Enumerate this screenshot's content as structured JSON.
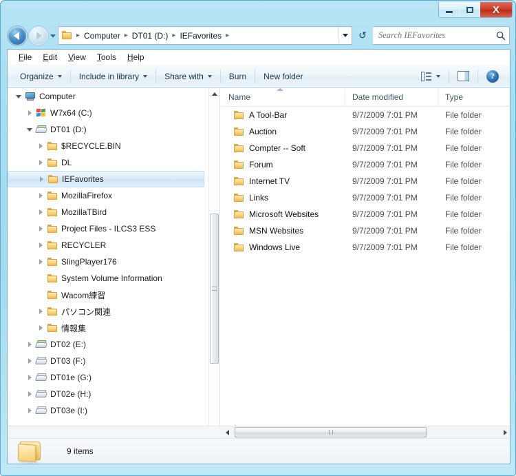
{
  "window": {
    "caption_buttons": {
      "minimize": "—",
      "maximize": "□",
      "close": "X"
    },
    "accent_color": "#a4dcef",
    "close_color": "#cf3b28"
  },
  "addressbar": {
    "back_icon": "back-arrow-icon",
    "forward_icon": "forward-arrow-icon",
    "recent_icon": "recent-pages-caret-icon",
    "folder_icon": "folder-icon",
    "crumbs": [
      "Computer",
      "DT01 (D:)",
      "IEFavorites"
    ],
    "separator": "▸",
    "dropdown_icon": "chevron-down-icon",
    "refresh_icon": "↺"
  },
  "search": {
    "placeholder": "Search IEFavorites",
    "value": "",
    "icon": "search-icon"
  },
  "menubar": {
    "items": [
      {
        "accel": "F",
        "rest": "ile"
      },
      {
        "accel": "E",
        "rest": "dit"
      },
      {
        "accel": "V",
        "rest": "iew"
      },
      {
        "accel": "T",
        "rest": "ools"
      },
      {
        "accel": "H",
        "rest": "elp"
      }
    ]
  },
  "commandbar": {
    "buttons": [
      {
        "label": "Organize",
        "caret": true
      },
      {
        "label": "Include in library",
        "caret": true
      },
      {
        "label": "Share with",
        "caret": true
      },
      {
        "label": "Burn",
        "caret": false
      },
      {
        "label": "New folder",
        "caret": false
      }
    ],
    "views_icon": "views-list-icon",
    "views_caret": "chevron-down-icon",
    "preview_icon": "preview-pane-icon",
    "help_icon": "help-icon",
    "help_glyph": "?"
  },
  "navpane": {
    "items": [
      {
        "label": "Computer",
        "indent": 0,
        "twisty": "open",
        "icon": "computer"
      },
      {
        "label": "W7x64 (C:)",
        "indent": 1,
        "twisty": "closed",
        "icon": "drive-win"
      },
      {
        "label": "DT01 (D:)",
        "indent": 1,
        "twisty": "open",
        "icon": "drive-sys"
      },
      {
        "label": "$RECYCLE.BIN",
        "indent": 2,
        "twisty": "closed",
        "icon": "folder"
      },
      {
        "label": "DL",
        "indent": 2,
        "twisty": "closed",
        "icon": "folder"
      },
      {
        "label": "IEFavorites",
        "indent": 2,
        "twisty": "closed",
        "icon": "folder",
        "selected": true
      },
      {
        "label": "MozillaFirefox",
        "indent": 2,
        "twisty": "closed",
        "icon": "folder"
      },
      {
        "label": "MozillaTBird",
        "indent": 2,
        "twisty": "closed",
        "icon": "folder"
      },
      {
        "label": "Project Files - ILCS3 ESS",
        "indent": 2,
        "twisty": "closed",
        "icon": "folder"
      },
      {
        "label": "RECYCLER",
        "indent": 2,
        "twisty": "closed",
        "icon": "folder"
      },
      {
        "label": "SlingPlayer176",
        "indent": 2,
        "twisty": "closed",
        "icon": "folder"
      },
      {
        "label": "System Volume Information",
        "indent": 2,
        "twisty": "none",
        "icon": "folder"
      },
      {
        "label": "Wacom練習",
        "indent": 2,
        "twisty": "none",
        "icon": "folder"
      },
      {
        "label": "パソコン関連",
        "indent": 2,
        "twisty": "closed",
        "icon": "folder"
      },
      {
        "label": "情報集",
        "indent": 2,
        "twisty": "closed",
        "icon": "folder"
      },
      {
        "label": "DT02 (E:)",
        "indent": 1,
        "twisty": "closed",
        "icon": "drive-sys"
      },
      {
        "label": "DT03 (F:)",
        "indent": 1,
        "twisty": "closed",
        "icon": "drive"
      },
      {
        "label": "DT01e (G:)",
        "indent": 1,
        "twisty": "closed",
        "icon": "drive"
      },
      {
        "label": "DT02e (H:)",
        "indent": 1,
        "twisty": "closed",
        "icon": "drive"
      },
      {
        "label": "DT03e (I:)",
        "indent": 1,
        "twisty": "closed",
        "icon": "drive"
      }
    ]
  },
  "filelist": {
    "columns": [
      "Name",
      "Date modified",
      "Type"
    ],
    "sort_column": "Name",
    "sort_direction": "ascending",
    "rows": [
      {
        "name": "A Tool-Bar",
        "date": "9/7/2009 7:01 PM",
        "type": "File folder"
      },
      {
        "name": "Auction",
        "date": "9/7/2009 7:01 PM",
        "type": "File folder"
      },
      {
        "name": "Compter -- Soft",
        "date": "9/7/2009 7:01 PM",
        "type": "File folder"
      },
      {
        "name": "Forum",
        "date": "9/7/2009 7:01 PM",
        "type": "File folder"
      },
      {
        "name": "Internet TV",
        "date": "9/7/2009 7:01 PM",
        "type": "File folder"
      },
      {
        "name": "Links",
        "date": "9/7/2009 7:01 PM",
        "type": "File folder"
      },
      {
        "name": "Microsoft Websites",
        "date": "9/7/2009 7:01 PM",
        "type": "File folder"
      },
      {
        "name": "MSN Websites",
        "date": "9/7/2009 7:01 PM",
        "type": "File folder"
      },
      {
        "name": "Windows Live",
        "date": "9/7/2009 7:01 PM",
        "type": "File folder"
      }
    ]
  },
  "statusbar": {
    "icon": "folder-icon",
    "text": "9 items"
  }
}
